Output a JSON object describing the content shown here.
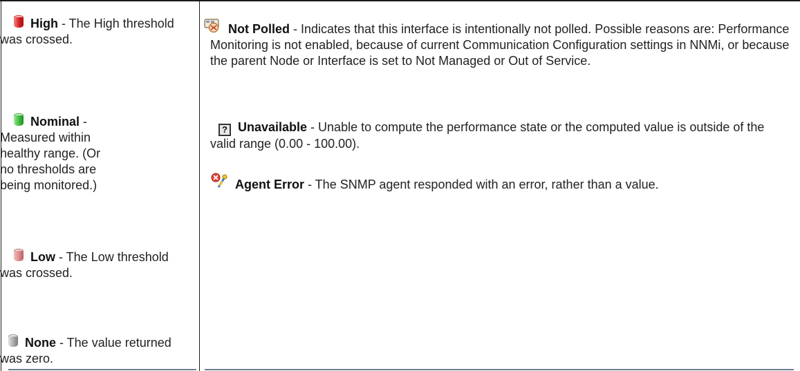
{
  "states": {
    "high": {
      "title": "High",
      "text": " - The High threshold was crossed.",
      "icon": "red-cylinder-icon"
    },
    "nominal": {
      "title": "Nominal",
      "text": " - Mea­sured within healthy range. (Or no thresh­olds are being mon­itored.)",
      "icon": "green-cylinder-icon"
    },
    "low": {
      "title": "Low",
      "text": " - The Low threshold was crossed.",
      "icon": "pink-cylinder-icon"
    },
    "none": {
      "title": "None",
      "text": " - The value returned was zero.",
      "icon": "gray-cylinder-icon"
    }
  },
  "statuses": {
    "not_polled": {
      "title": "Not Polled",
      "text": " - Indicates that this interface is intentionally not polled. Possible reasons are: Performance Monitoring is not enabled, because of current Com­munication Configuration settings in NNMi, or because the parent Node or Interface is set to Not Managed or Out of Service.",
      "icon": "not-polled-icon"
    },
    "unavailable": {
      "title": "Unavailable",
      "text": " - Unable to compute the performance state or the computed value is outside of the valid range (0.00 - 100.00).",
      "icon": "question-box-icon",
      "glyph": "?"
    },
    "agent_error": {
      "title": "Agent Error",
      "text": " - The SNMP agent responded with an error, rather than a value.",
      "icon": "agent-error-icon"
    }
  }
}
